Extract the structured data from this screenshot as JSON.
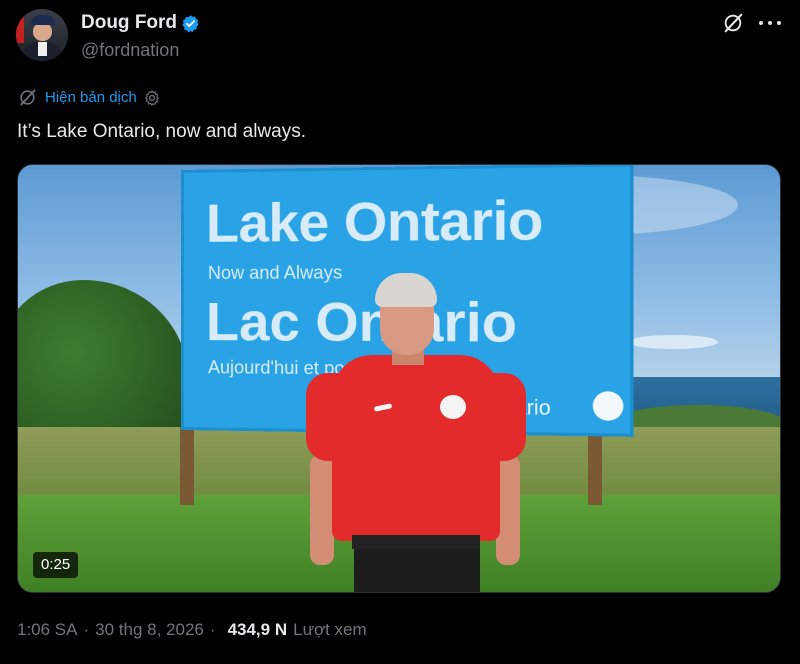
{
  "author": {
    "display_name": "Doug Ford",
    "handle": "@fordnation",
    "verified": true,
    "avatar_icon": "profile-photo"
  },
  "header_actions": {
    "grok_icon": "grok-slash-icon",
    "more_icon": "more-dots-icon"
  },
  "translate": {
    "label": "Hiện bản dịch",
    "globe_icon": "translate-globe-icon",
    "settings_icon": "gear-icon"
  },
  "tweet": {
    "text": "It’s Lake Ontario, now and always."
  },
  "media": {
    "sign_title_en": "Lake Ontario",
    "sign_sub_en": "Now and Always",
    "sign_title_fr": "Lac Ontario",
    "sign_sub_fr": "Aujourd'hui et pour",
    "sign_brand": "ario",
    "duration": "0:25"
  },
  "meta": {
    "time": "1:06 SA",
    "date": "30 thg 8, 2026",
    "views_count": "434,9 N",
    "views_label": "Lượt xem",
    "separator": "·"
  },
  "colors": {
    "accent": "#1d9bf0",
    "background": "#000000",
    "text_primary": "#e7e9ea",
    "text_secondary": "#71767b"
  }
}
